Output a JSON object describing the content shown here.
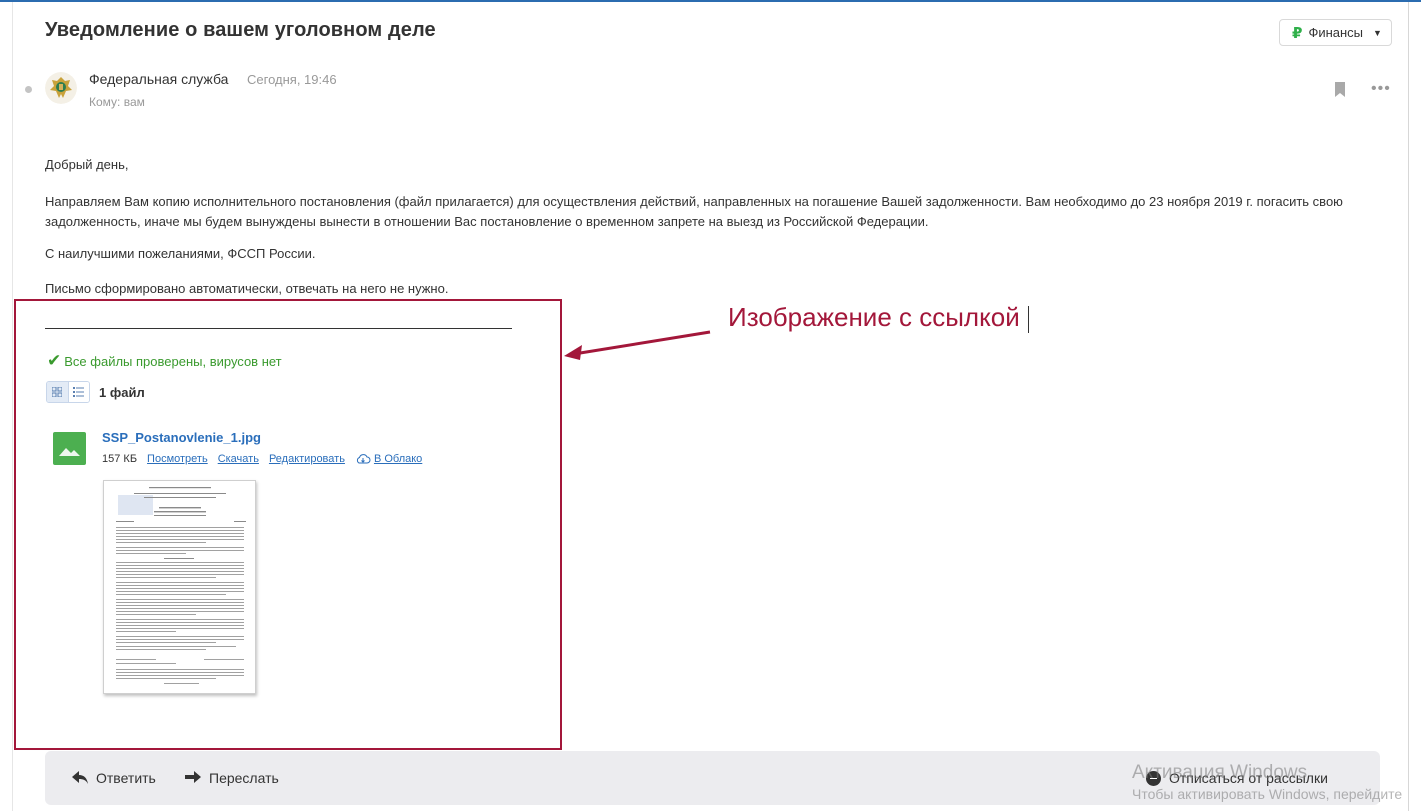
{
  "email": {
    "subject": "Уведомление о вашем уголовном деле",
    "folder": {
      "label": "Финансы",
      "icon": "ruble-icon"
    },
    "sender": "Федеральная служба",
    "date": "Сегодня, 19:46",
    "to_label": "Кому:",
    "to_value": "вам",
    "body": {
      "greeting": "Добрый день,",
      "paragraph": "Направляем Вам копию исполнительного постановления (файл прилагается) для осуществления действий, направленных на погашение Вашей задолженности. Вам необходимо до 23 ноября 2019 г. погасить свою задолженность, иначе мы будем вынуждены вынести в отношении Вас постановление о временном запрете на выезд из Российской Федерации.",
      "closing": "С наилучшими пожеланиями, ФССП России.",
      "auto_note": "Письмо сформировано автоматически, отвечать на него не нужно."
    }
  },
  "attachments": {
    "virus_check": "Все файлы проверены, вирусов нет",
    "count_label": "1 файл",
    "file": {
      "name": "SSP_Postanovlenie_1.jpg",
      "size": "157 КБ",
      "actions": {
        "view": "Посмотреть",
        "download": "Скачать",
        "edit": "Редактировать",
        "cloud": "В Облако"
      }
    }
  },
  "annotation": {
    "label": "Изображение с ссылкой",
    "color": "#a3173a"
  },
  "footer": {
    "reply": "Ответить",
    "forward": "Переслать",
    "unsubscribe": "Отписаться от рассылки"
  },
  "watermark": {
    "line1": "Активация Windows",
    "line2": "Чтобы активировать Windows, перейдите"
  }
}
